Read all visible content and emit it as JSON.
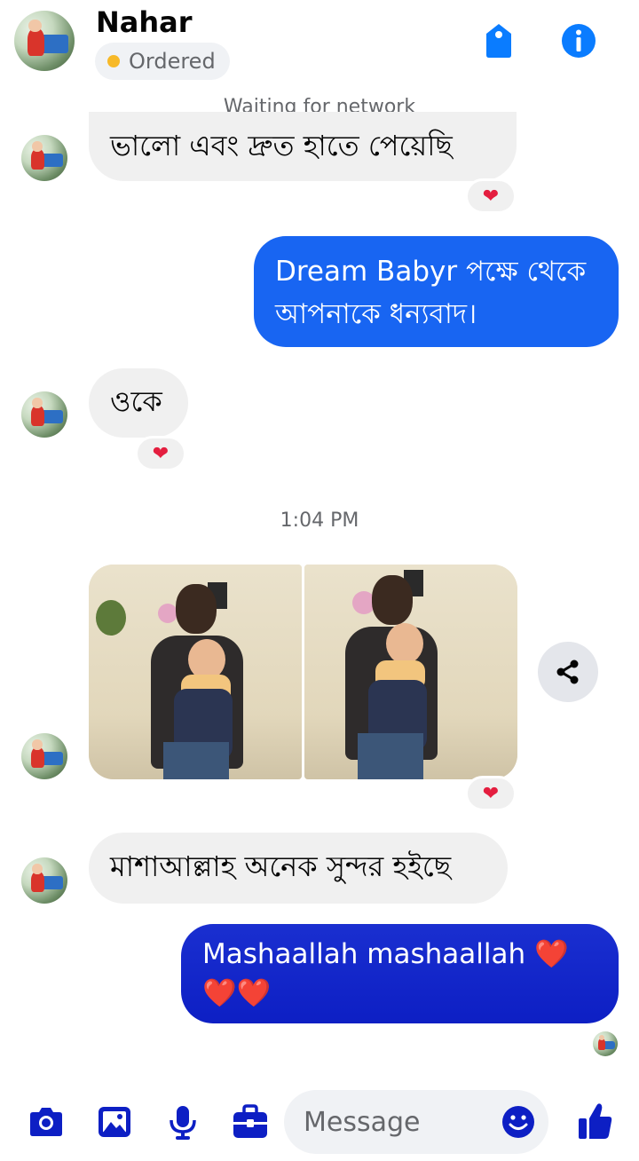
{
  "header": {
    "title": "Nahar",
    "status": "Ordered",
    "tag_icon": "tag-icon",
    "info_icon": "info-icon"
  },
  "network_status": "Waiting for network",
  "timestamp": "1:04 PM",
  "messages": [
    {
      "direction": "incoming",
      "text": "ভালো এবং দ্রুত হাতে পেয়েছি",
      "reaction": "❤"
    },
    {
      "direction": "outgoing",
      "text": "Dream Babyr পক্ষে থেকে আপনাকে ধন্যবাদ।"
    },
    {
      "direction": "incoming",
      "text": "ওকে",
      "reaction": "❤"
    },
    {
      "direction": "incoming",
      "type": "photos",
      "count": 2,
      "reaction": "❤"
    },
    {
      "direction": "incoming",
      "text": "মাশাআল্লাহ অনেক সুন্দর হইছে"
    },
    {
      "direction": "outgoing",
      "text_line1": "Mashaallah mashaallah ❤️",
      "text_line2": "❤️❤️"
    }
  ],
  "composer": {
    "placeholder": "Message",
    "icons": [
      "camera-icon",
      "gallery-icon",
      "microphone-icon",
      "briefcase-icon",
      "emoji-icon",
      "like-icon"
    ]
  },
  "colors": {
    "accent": "#0a7cff",
    "outgoing_blue": "#1865f2",
    "outgoing_deep": "#0d1fc4",
    "incoming_bg": "#f0f0f0",
    "reaction": "#e41e3f",
    "status_dot": "#f7b928"
  }
}
